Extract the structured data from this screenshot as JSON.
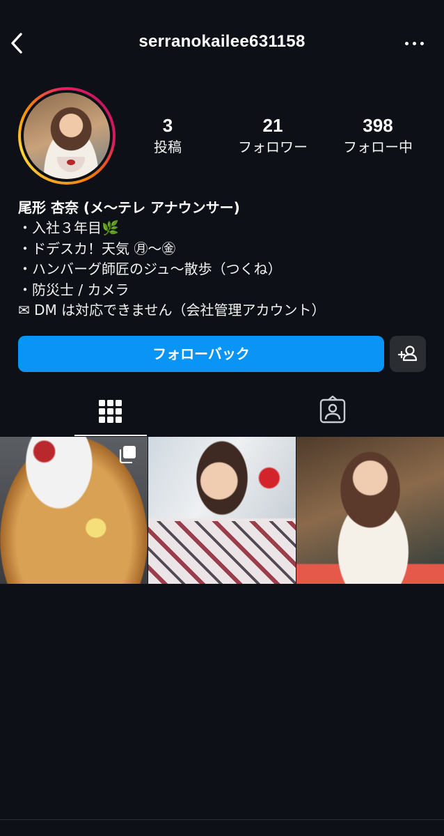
{
  "header": {
    "username": "serranokailee631158",
    "back_icon": "chevron-left-icon",
    "more_icon": "more-horizontal-icon"
  },
  "profile": {
    "avatar_icon": "avatar",
    "stats": [
      {
        "value": "3",
        "label": "投稿"
      },
      {
        "value": "21",
        "label": "フォロワー"
      },
      {
        "value": "398",
        "label": "フォロー中"
      }
    ]
  },
  "bio": {
    "name": "尾形 杏奈 (メ〜テレ アナウンサー)",
    "lines": [
      "・入社３年目🌿",
      "・ドデスカ！天気 ㊊〜㊎",
      "・ハンバーグ師匠のジュ〜散歩（つくね）",
      "・防災士 / カメラ",
      "✉ DM は対応できません（会社管理アカウント）"
    ]
  },
  "actions": {
    "follow_back_label": "フォローバック",
    "add_person_icon": "add-person-icon"
  },
  "tabs": [
    {
      "icon": "grid-icon",
      "active": true
    },
    {
      "icon": "tagged-person-icon",
      "active": false
    }
  ],
  "posts": [
    {
      "subject": "crepe",
      "multi": true
    },
    {
      "subject": "yukata-peace-sign",
      "multi": false
    },
    {
      "subject": "cafe-dessert",
      "multi": false
    }
  ],
  "colors": {
    "background": "#0d1117",
    "accent_blue": "#0a95f6",
    "secondary_button": "#2a2e33",
    "text": "#f2f2f2"
  }
}
